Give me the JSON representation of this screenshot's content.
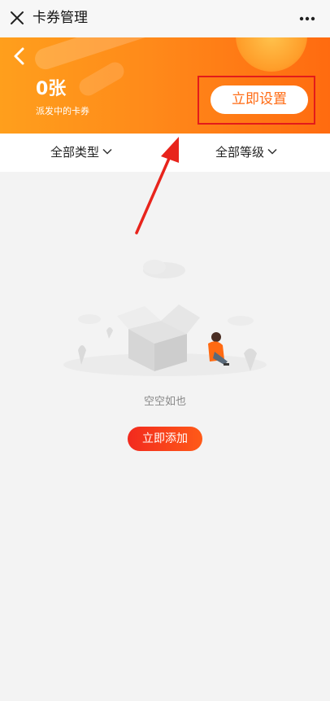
{
  "navbar": {
    "title": "卡券管理"
  },
  "banner": {
    "count": "0张",
    "subtitle": "派发中的卡券",
    "action_label": "立即设置"
  },
  "filters": {
    "type_label": "全部类型",
    "level_label": "全部等级"
  },
  "empty": {
    "text": "空空如也",
    "add_label": "立即添加"
  },
  "colors": {
    "banner_start": "#ff9f1c",
    "banner_end": "#ff6b10",
    "accent": "#ff6a12",
    "annotation": "#e31b1b",
    "add_button": "#f22a1e"
  }
}
